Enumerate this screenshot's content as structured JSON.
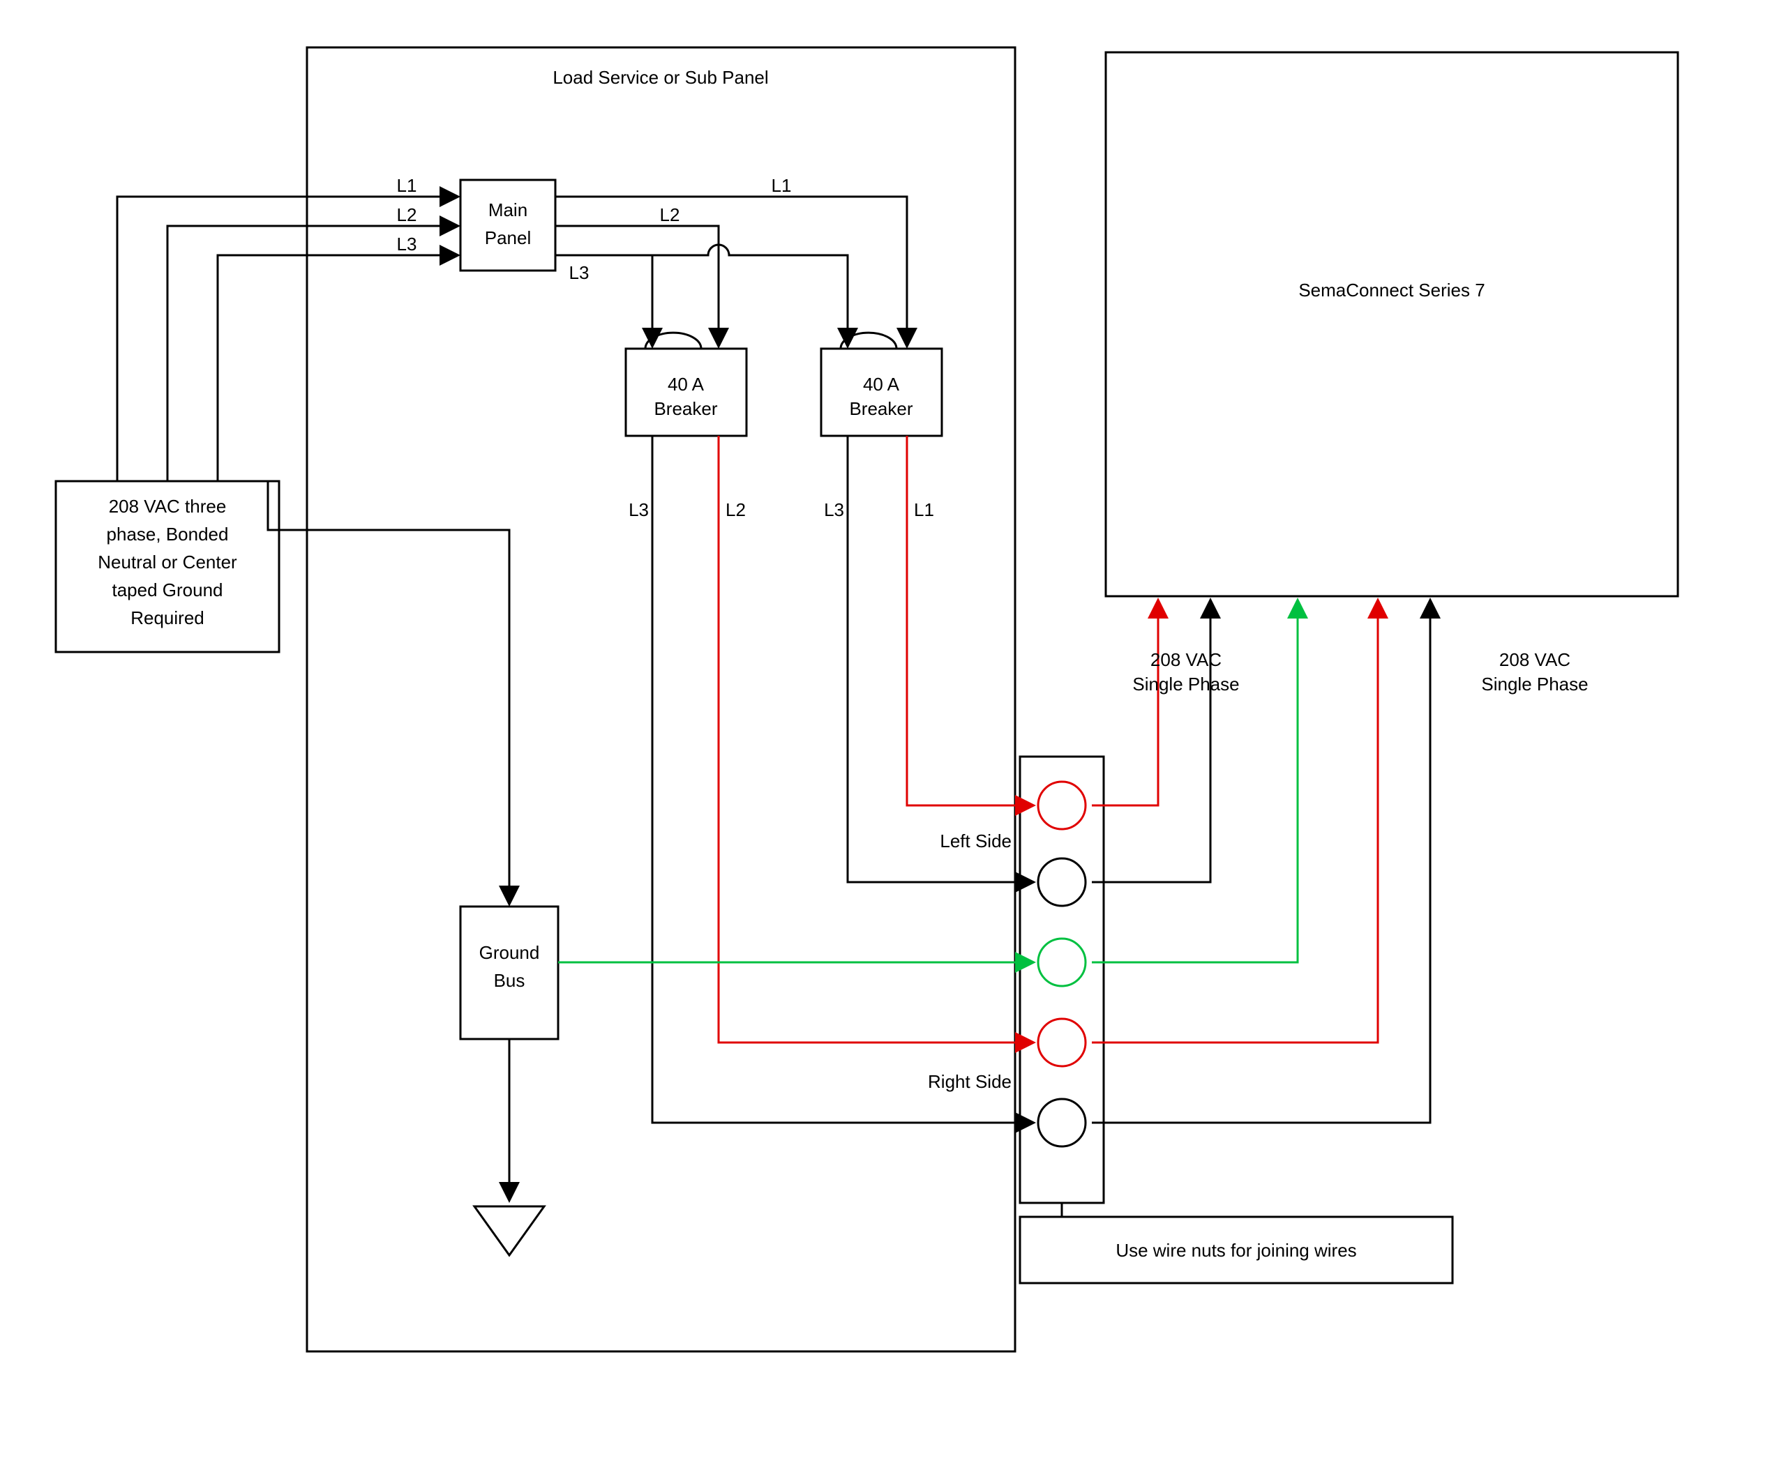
{
  "diagram": {
    "panel_title": "Load Service or Sub Panel",
    "source": {
      "line1": "208 VAC three",
      "line2": "phase, Bonded",
      "line3": "Neutral or Center",
      "line4": "taped Ground",
      "line5": "Required"
    },
    "main_panel": {
      "line1": "Main",
      "line2": "Panel"
    },
    "breaker1": {
      "line1": "40 A",
      "line2": "Breaker"
    },
    "breaker2": {
      "line1": "40 A",
      "line2": "Breaker"
    },
    "ground_bus": {
      "line1": "Ground",
      "line2": "Bus"
    },
    "sema": "SemaConnect Series 7",
    "phase1": {
      "line1": "208 VAC",
      "line2": "Single Phase"
    },
    "phase2": {
      "line1": "208 VAC",
      "line2": "Single Phase"
    },
    "labels": {
      "L1a": "L1",
      "L2a": "L2",
      "L3a": "L3",
      "L1b": "L1",
      "L2b": "L2",
      "L3b": "L3",
      "b1_L3": "L3",
      "b1_L2": "L2",
      "b2_L3": "L3",
      "b2_L1": "L1",
      "left_side": "Left Side",
      "right_side": "Right Side",
      "wire_nuts": "Use wire nuts for joining wires"
    },
    "colors": {
      "l1": "#e00000",
      "l2": "#e00000",
      "gnd": "#00c040",
      "wire": "#000000"
    }
  }
}
